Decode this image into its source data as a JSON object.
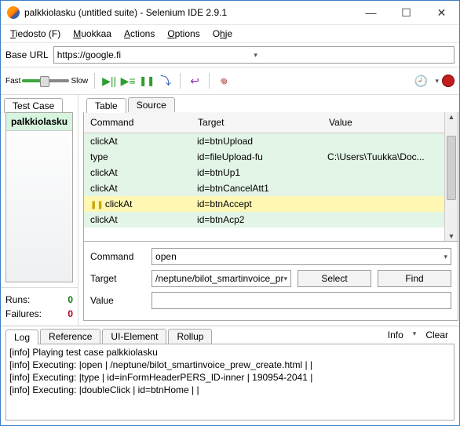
{
  "window": {
    "title": "palkkiolasku (untitled suite) - Selenium IDE 2.9.1",
    "minimize_icon": "—",
    "maximize_icon": "☐",
    "close_icon": "✕"
  },
  "menu": {
    "tiedosto": "T̲iedosto (F)",
    "muokkaa": "M̲uokkaa",
    "actions": "A̲ctions",
    "options": "O̲ptions",
    "ohje": "Oh̲je"
  },
  "base_url": {
    "label": "Base URL",
    "value": "https://google.fi"
  },
  "speed": {
    "fast": "Fast",
    "slow": "Slow"
  },
  "icons": {
    "clock": "🕘",
    "dropdown": "▾",
    "play1": "▶||",
    "play2": "▶≡",
    "pause": "❚❚",
    "step": "⤵",
    "uturn": "↩",
    "swirl": "𖦹",
    "scroll_up": "▲",
    "scroll_down": "▼"
  },
  "left_tab": {
    "label": "Test Case"
  },
  "testcases": {
    "name": "palkkiolasku"
  },
  "stats": {
    "runs_label": "Runs:",
    "runs_value": "0",
    "fail_label": "Failures:",
    "fail_value": "0"
  },
  "grid_tabs": {
    "table": "Table",
    "source": "Source"
  },
  "grid_header": {
    "command": "Command",
    "target": "Target",
    "value": "Value"
  },
  "grid_rows": [
    {
      "command": "clickAt",
      "target": "id=btnUpload",
      "value": ""
    },
    {
      "command": "type",
      "target": "id=fileUpload-fu",
      "value": "C:\\Users\\Tuukka\\Doc..."
    },
    {
      "command": "clickAt",
      "target": "id=btnUp1",
      "value": ""
    },
    {
      "command": "clickAt",
      "target": "id=btnCancelAtt1",
      "value": ""
    },
    {
      "command": "clickAt",
      "target": "id=btnAccept",
      "value": "",
      "selected": true,
      "bp": true
    },
    {
      "command": "clickAt",
      "target": "id=btnAcp2",
      "value": ""
    }
  ],
  "form": {
    "command_label": "Command",
    "command_value": "open",
    "target_label": "Target",
    "target_value": "/neptune/bilot_smartinvoice_pr",
    "value_label": "Value",
    "value_value": "",
    "select_btn": "Select",
    "find_btn": "Find"
  },
  "bottom_tabs": {
    "log": "Log",
    "reference": "Reference",
    "ui": "UI-Element",
    "rollup": "Rollup",
    "info": "Info",
    "clear": "Clear",
    "dropdown": "▾"
  },
  "log": [
    "[info] Playing test case palkkiolasku",
    "[info] Executing: |open | /neptune/bilot_smartinvoice_prew_create.html | |",
    "[info] Executing: |type | id=inFormHeaderPERS_ID-inner | 190954-2041 |",
    "[info] Executing: |doubleClick | id=btnHome | |"
  ]
}
